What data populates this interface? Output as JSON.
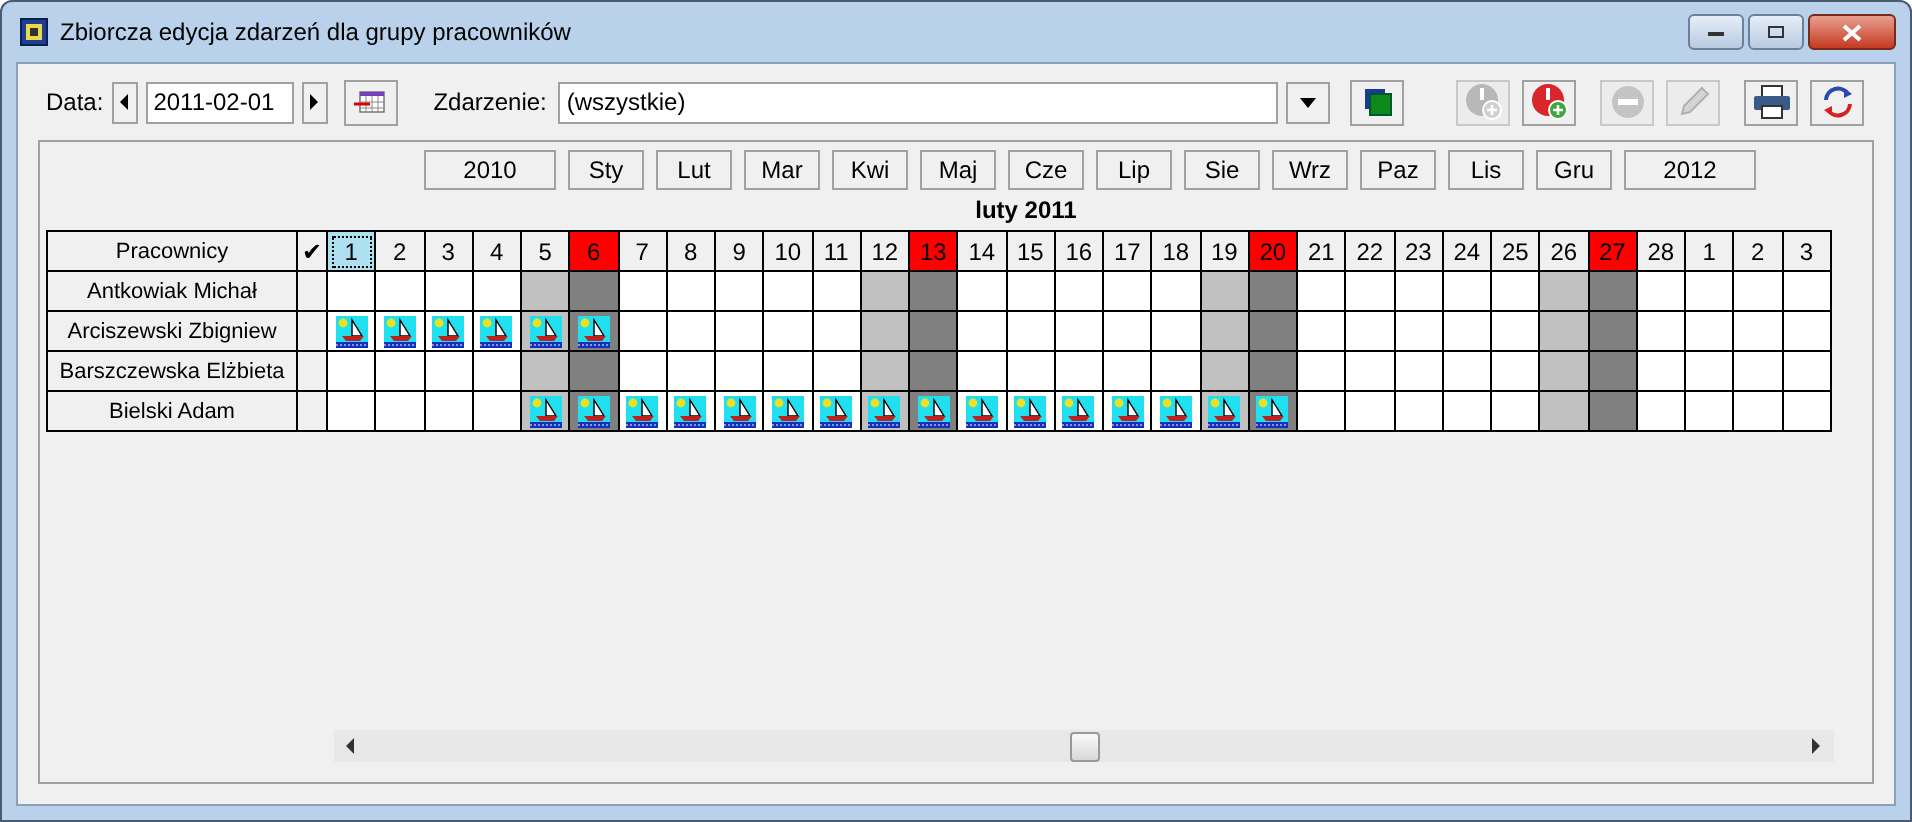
{
  "window": {
    "title": "Zbiorcza edycja zdarzeń dla grupy pracowników"
  },
  "toolbar": {
    "date_label": "Data:",
    "date_value": "2011-02-01",
    "event_label": "Zdarzenie:",
    "event_value": "(wszystkie)",
    "tools": [
      {
        "kind": "clock-add",
        "disabled": true
      },
      {
        "kind": "alarm-add",
        "disabled": false
      },
      {
        "kind": "remove",
        "disabled": true
      },
      {
        "kind": "edit",
        "disabled": true
      },
      {
        "kind": "print",
        "disabled": false
      },
      {
        "kind": "refresh",
        "disabled": false
      }
    ]
  },
  "months": [
    "2010",
    "Sty",
    "Lut",
    "Mar",
    "Kwi",
    "Maj",
    "Cze",
    "Lip",
    "Sie",
    "Wrz",
    "Paz",
    "Lis",
    "Gru",
    "2012"
  ],
  "calendar": {
    "title": "luty 2011",
    "name_header": "Pracownicy",
    "check_header": "✔",
    "days": [
      {
        "label": "1",
        "kind": "weekday",
        "selected": true
      },
      {
        "label": "2",
        "kind": "weekday",
        "selected": false
      },
      {
        "label": "3",
        "kind": "weekday",
        "selected": false
      },
      {
        "label": "4",
        "kind": "weekday",
        "selected": false
      },
      {
        "label": "5",
        "kind": "saturday",
        "selected": false
      },
      {
        "label": "6",
        "kind": "sunday",
        "selected": false
      },
      {
        "label": "7",
        "kind": "weekday",
        "selected": false
      },
      {
        "label": "8",
        "kind": "weekday",
        "selected": false
      },
      {
        "label": "9",
        "kind": "weekday",
        "selected": false
      },
      {
        "label": "10",
        "kind": "weekday",
        "selected": false
      },
      {
        "label": "11",
        "kind": "weekday",
        "selected": false
      },
      {
        "label": "12",
        "kind": "saturday",
        "selected": false
      },
      {
        "label": "13",
        "kind": "sunday",
        "selected": false
      },
      {
        "label": "14",
        "kind": "weekday",
        "selected": false
      },
      {
        "label": "15",
        "kind": "weekday",
        "selected": false
      },
      {
        "label": "16",
        "kind": "weekday",
        "selected": false
      },
      {
        "label": "17",
        "kind": "weekday",
        "selected": false
      },
      {
        "label": "18",
        "kind": "weekday",
        "selected": false
      },
      {
        "label": "19",
        "kind": "saturday",
        "selected": false
      },
      {
        "label": "20",
        "kind": "sunday",
        "selected": false
      },
      {
        "label": "21",
        "kind": "weekday",
        "selected": false
      },
      {
        "label": "22",
        "kind": "weekday",
        "selected": false
      },
      {
        "label": "23",
        "kind": "weekday",
        "selected": false
      },
      {
        "label": "24",
        "kind": "weekday",
        "selected": false
      },
      {
        "label": "25",
        "kind": "weekday",
        "selected": false
      },
      {
        "label": "26",
        "kind": "saturday",
        "selected": false
      },
      {
        "label": "27",
        "kind": "sunday",
        "selected": false
      },
      {
        "label": "28",
        "kind": "weekday",
        "selected": false
      },
      {
        "label": "1",
        "kind": "weekday",
        "selected": false
      },
      {
        "label": "2",
        "kind": "weekday",
        "selected": false
      },
      {
        "label": "3",
        "kind": "weekday",
        "selected": false
      }
    ],
    "employees": [
      {
        "name": "Antkowiak Michał",
        "vacation": [
          false,
          false,
          false,
          false,
          false,
          false,
          false,
          false,
          false,
          false,
          false,
          false,
          false,
          false,
          false,
          false,
          false,
          false,
          false,
          false,
          false,
          false,
          false,
          false,
          false,
          false,
          false,
          false,
          false,
          false,
          false
        ]
      },
      {
        "name": "Arciszewski Zbigniew",
        "vacation": [
          true,
          true,
          true,
          true,
          true,
          true,
          false,
          false,
          false,
          false,
          false,
          false,
          false,
          false,
          false,
          false,
          false,
          false,
          false,
          false,
          false,
          false,
          false,
          false,
          false,
          false,
          false,
          false,
          false,
          false,
          false
        ]
      },
      {
        "name": "Barszczewska Elżbieta",
        "vacation": [
          false,
          false,
          false,
          false,
          false,
          false,
          false,
          false,
          false,
          false,
          false,
          false,
          false,
          false,
          false,
          false,
          false,
          false,
          false,
          false,
          false,
          false,
          false,
          false,
          false,
          false,
          false,
          false,
          false,
          false,
          false
        ]
      },
      {
        "name": "Bielski Adam",
        "vacation": [
          false,
          false,
          false,
          false,
          true,
          true,
          true,
          true,
          true,
          true,
          true,
          true,
          true,
          true,
          true,
          true,
          true,
          true,
          true,
          true,
          false,
          false,
          false,
          false,
          false,
          false,
          false,
          false,
          false,
          false,
          false
        ]
      }
    ]
  }
}
